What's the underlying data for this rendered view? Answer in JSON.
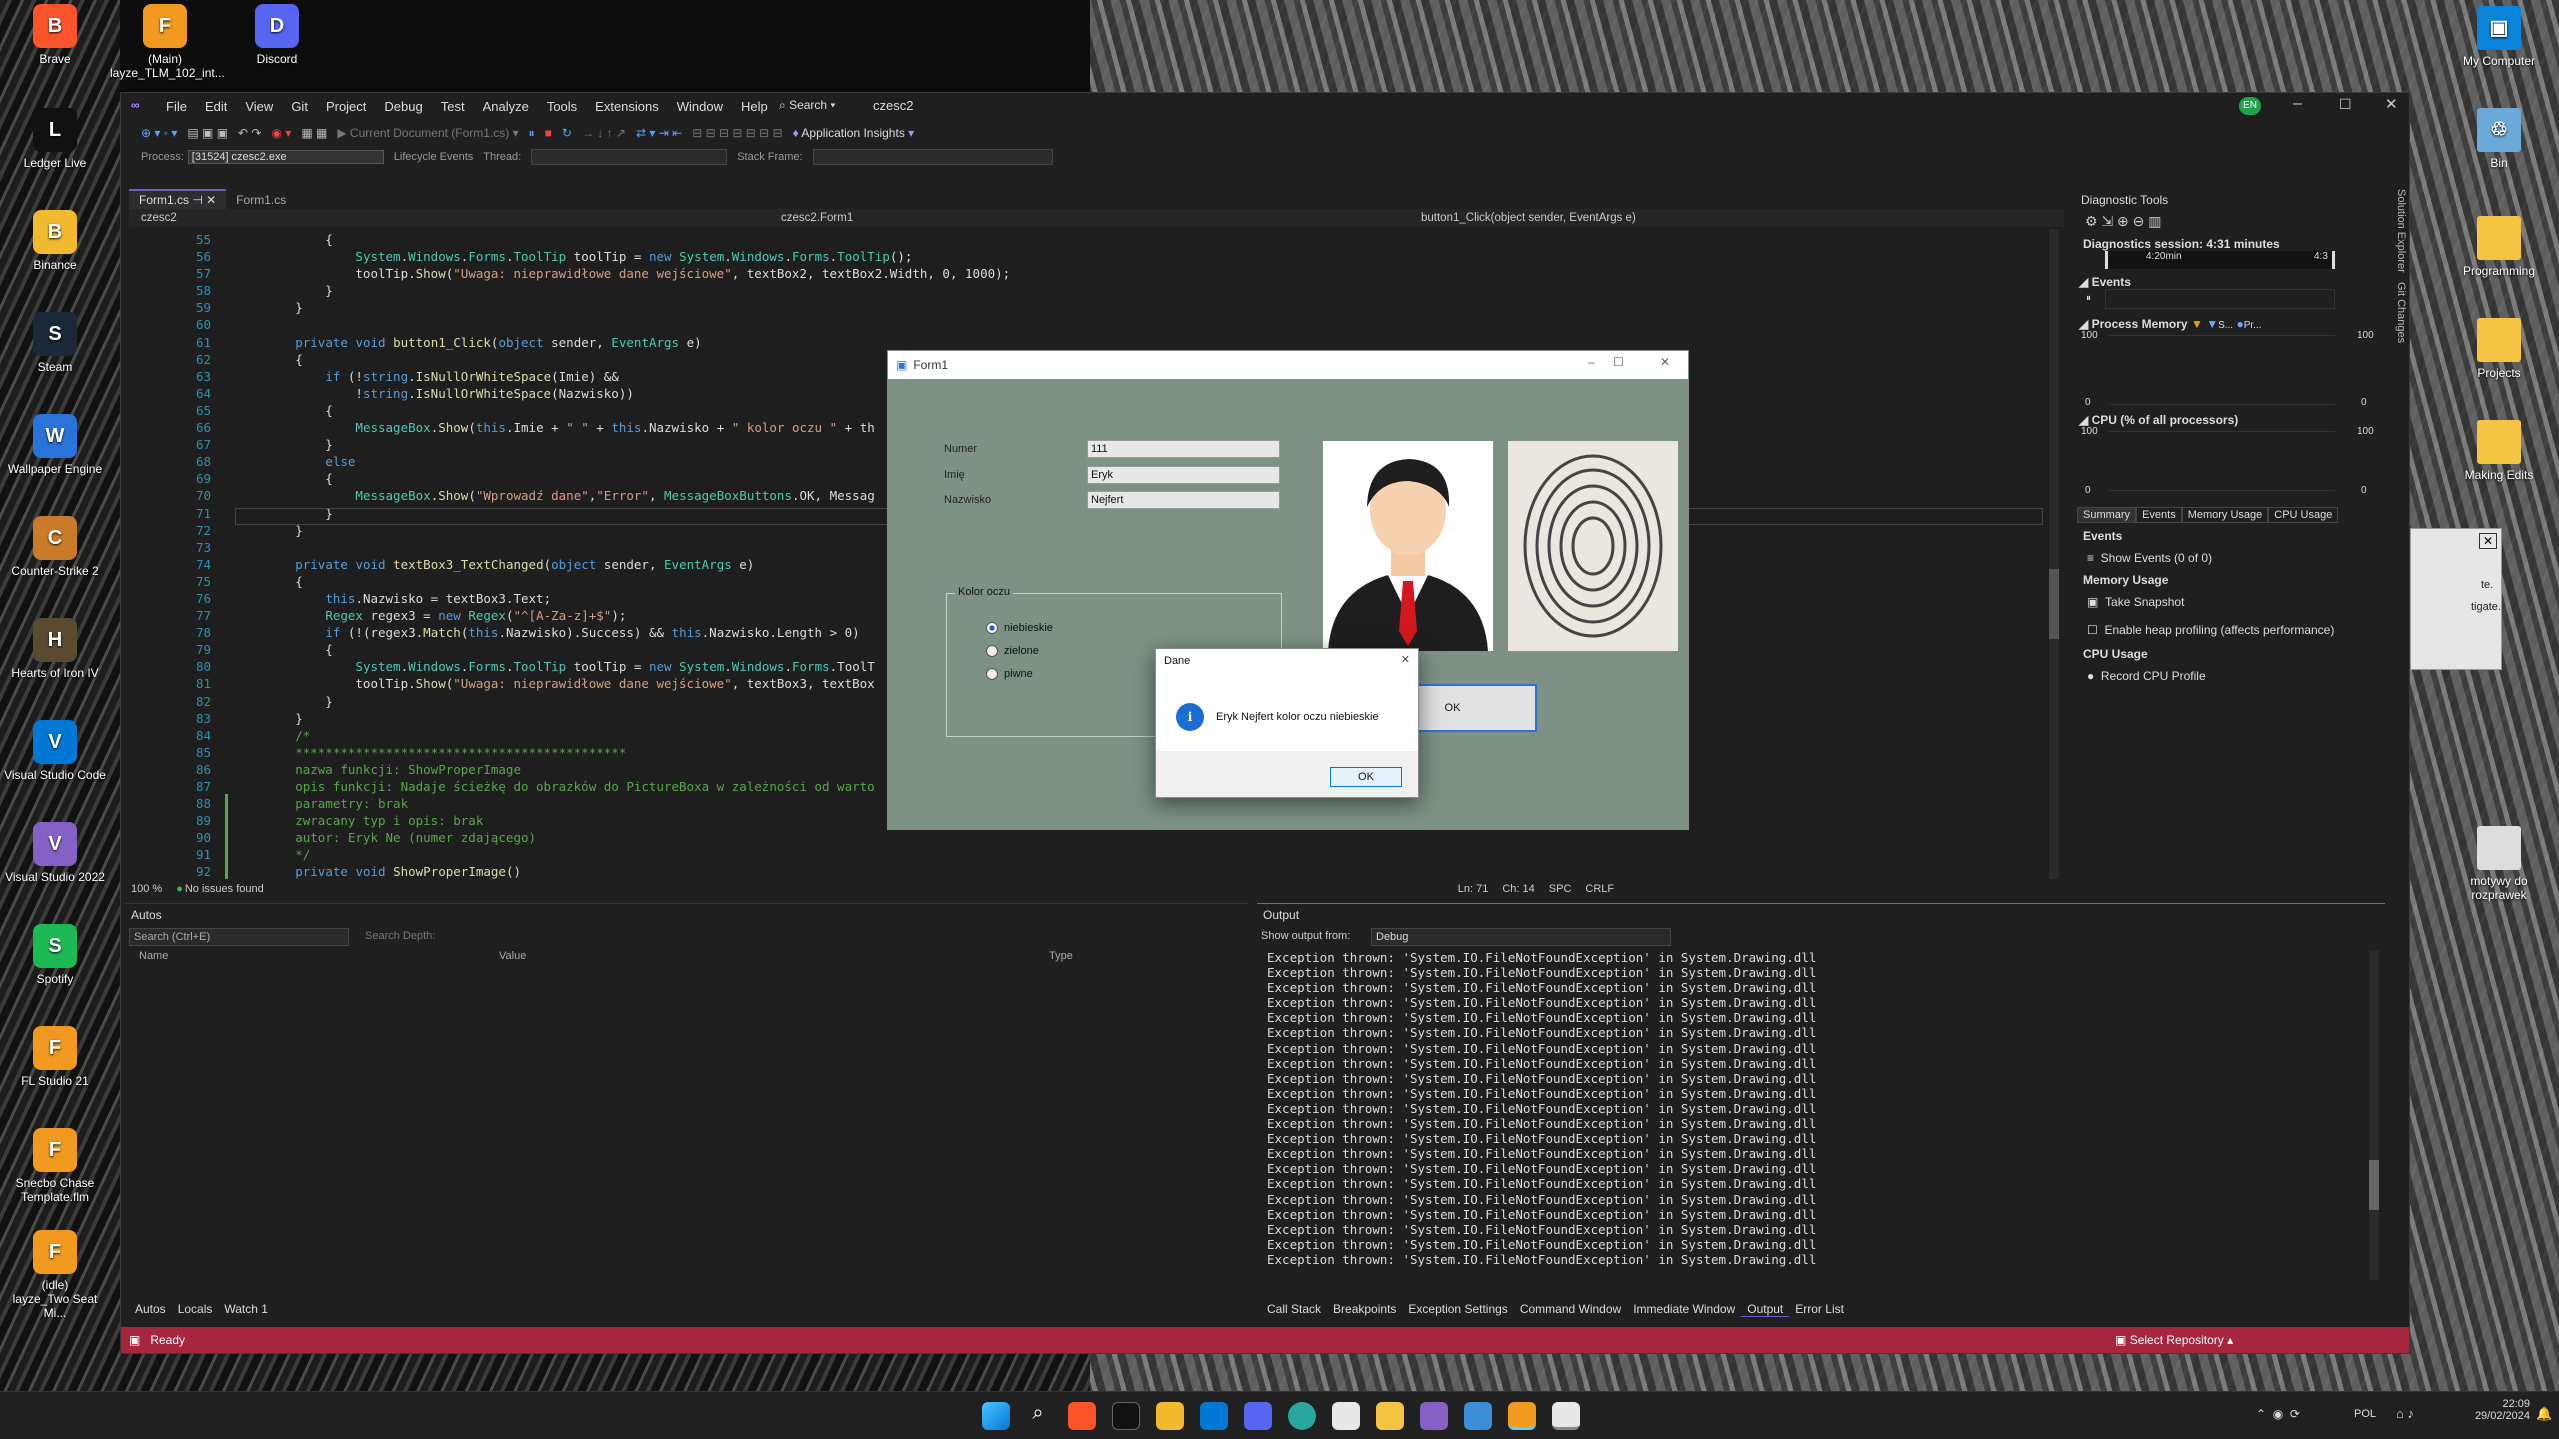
{
  "desktop_left": [
    {
      "label": "Brave",
      "color": "#fb542b",
      "glyph": "B"
    },
    {
      "label": "(Main)\nlayze_TLM_102_int...",
      "color": "#f29a1f",
      "glyph": "F"
    },
    {
      "label": "Discord",
      "color": "#5865f2",
      "glyph": "D"
    },
    {
      "label": "Ledger Live",
      "color": "#111",
      "glyph": "L"
    },
    {
      "label": "Binance",
      "color": "#f3ba2f",
      "glyph": "B"
    },
    {
      "label": "Steam",
      "color": "#1b2838",
      "glyph": "S"
    },
    {
      "label": "Wallpaper Engine",
      "color": "#2a73d9",
      "glyph": "W"
    },
    {
      "label": "Counter-Strike 2",
      "color": "#c97b2a",
      "glyph": "C"
    },
    {
      "label": "Hearts of Iron IV",
      "color": "#5a4a32",
      "glyph": "H"
    },
    {
      "label": "Visual Studio Code",
      "color": "#0078d4",
      "glyph": "V"
    },
    {
      "label": "Visual Studio 2022",
      "color": "#8661c5",
      "glyph": "V"
    },
    {
      "label": "Spotify",
      "color": "#1db954",
      "glyph": "S"
    },
    {
      "label": "FL Studio 21",
      "color": "#f29a1f",
      "glyph": "F"
    },
    {
      "label": "Snecbo Chase Template.flm",
      "color": "#f29a1f",
      "glyph": "F"
    },
    {
      "label": "(idle)\nlayze_Two Seat Mi...",
      "color": "#f29a1f",
      "glyph": "F"
    }
  ],
  "desktop_right": [
    {
      "label": "My Computer",
      "color": "#0a84d8",
      "glyph": "▣"
    },
    {
      "label": "Bin",
      "color": "#6aa9d8",
      "glyph": "♲"
    },
    {
      "label": "Programming",
      "color": "#f4c542",
      "glyph": ""
    },
    {
      "label": "Projects",
      "color": "#f4c542",
      "glyph": ""
    },
    {
      "label": "Making Edits",
      "color": "#f4c542",
      "glyph": ""
    },
    {
      "label": "motywy do rozprawek",
      "color": "#ddd",
      "glyph": ""
    }
  ],
  "vs": {
    "menu": [
      "File",
      "Edit",
      "View",
      "Git",
      "Project",
      "Debug",
      "Test",
      "Analyze",
      "Tools",
      "Extensions",
      "Window",
      "Help"
    ],
    "search": "Search",
    "solution": "czesc2",
    "lang_badge": "EN",
    "toolbar_current_doc": "Current Document (Form1.cs)",
    "app_insights": "Application Insights",
    "process_label": "Process:",
    "process_value": "[31524] czesc2.exe",
    "lifecycle": "Lifecycle Events",
    "thread": "Thread:",
    "stack_frame": "Stack Frame:",
    "tabs": [
      "Form1.cs",
      "Form1.cs"
    ],
    "nav": [
      "czesc2",
      "czesc2.Form1",
      "button1_Click(object sender, EventArgs e)"
    ],
    "zoom": "100 %",
    "issues": "No issues found",
    "pos": [
      "Ln: 71",
      "Ch: 14",
      "SPC",
      "CRLF"
    ],
    "status": "Ready",
    "select_repo": "Select Repository"
  },
  "code_lines": [
    {
      "n": "55",
      "t": "            {"
    },
    {
      "n": "56",
      "t": "                System.Windows.Forms.ToolTip toolTip = new System.Windows.Forms.ToolTip();"
    },
    {
      "n": "57",
      "t": "                toolTip.Show(\"Uwaga: nieprawidłowe dane wejściowe\", textBox2, textBox2.Width, 0, 1000);"
    },
    {
      "n": "58",
      "t": "            }"
    },
    {
      "n": "59",
      "t": "        }"
    },
    {
      "n": "60",
      "t": ""
    },
    {
      "n": "61",
      "t": "        private void button1_Click(object sender, EventArgs e)"
    },
    {
      "n": "62",
      "t": "        {"
    },
    {
      "n": "63",
      "t": "            if (!string.IsNullOrWhiteSpace(Imie) &&"
    },
    {
      "n": "64",
      "t": "                !string.IsNullOrWhiteSpace(Nazwisko))"
    },
    {
      "n": "65",
      "t": "            {"
    },
    {
      "n": "66",
      "t": "                MessageBox.Show(this.Imie + \" \" + this.Nazwisko + \" kolor oczu \" + th"
    },
    {
      "n": "67",
      "t": "            }"
    },
    {
      "n": "68",
      "t": "            else"
    },
    {
      "n": "69",
      "t": "            {"
    },
    {
      "n": "70",
      "t": "                MessageBox.Show(\"Wprowadź dane\",\"Error\", MessageBoxButtons.OK, Messag"
    },
    {
      "n": "71",
      "t": "            }"
    },
    {
      "n": "72",
      "t": "        }"
    },
    {
      "n": "73",
      "t": ""
    },
    {
      "n": "74",
      "t": "        private void textBox3_TextChanged(object sender, EventArgs e)"
    },
    {
      "n": "75",
      "t": "        {"
    },
    {
      "n": "76",
      "t": "            this.Nazwisko = textBox3.Text;"
    },
    {
      "n": "77",
      "t": "            Regex regex3 = new Regex(\"^[A-Za-z]+$\");"
    },
    {
      "n": "78",
      "t": "            if (!(regex3.Match(this.Nazwisko).Success) && this.Nazwisko.Length > 0)"
    },
    {
      "n": "79",
      "t": "            {"
    },
    {
      "n": "80",
      "t": "                System.Windows.Forms.ToolTip toolTip = new System.Windows.Forms.ToolT"
    },
    {
      "n": "81",
      "t": "                toolTip.Show(\"Uwaga: nieprawidłowe dane wejściowe\", textBox3, textBox"
    },
    {
      "n": "82",
      "t": "            }"
    },
    {
      "n": "83",
      "t": "        }"
    },
    {
      "n": "84",
      "t": "        /*"
    },
    {
      "n": "85",
      "t": "        ********************************************"
    },
    {
      "n": "86",
      "t": "        nazwa funkcji: ShowProperImage"
    },
    {
      "n": "87",
      "t": "        opis funkcji: Nadaje ścieżkę do obrazków do PictureBoxa w zależności od warto"
    },
    {
      "n": "88",
      "t": "        parametry: brak"
    },
    {
      "n": "89",
      "t": "        zwracany typ i opis: brak"
    },
    {
      "n": "90",
      "t": "        autor: Eryk Ne (numer zdającego)"
    },
    {
      "n": "91",
      "t": "        */"
    },
    {
      "n": "92",
      "t": "        private void ShowProperImage()"
    }
  ],
  "autos": {
    "title": "Autos",
    "search": "Search (Ctrl+E)",
    "depth": "Search Depth:",
    "cols": [
      "Name",
      "Value",
      "Type"
    ],
    "tabs": [
      "Autos",
      "Locals",
      "Watch 1"
    ]
  },
  "output": {
    "title": "Output",
    "show_from": "Show output from:",
    "source": "Debug",
    "line": "Exception thrown: 'System.IO.FileNotFoundException' in System.Drawing.dll",
    "count": 21,
    "tabs": [
      "Call Stack",
      "Breakpoints",
      "Exception Settings",
      "Command Window",
      "Immediate Window",
      "Output",
      "Error List"
    ]
  },
  "diag": {
    "title": "Diagnostic Tools",
    "session": "Diagnostics session: 4:31 minutes",
    "t1": "4:20min",
    "t2": "4:3",
    "events": "Events",
    "mem": "Process Memory",
    "mem_legend": [
      "S...",
      "Pr..."
    ],
    "cpu": "CPU (% of all processors)",
    "axis_top": "100",
    "axis_bot": "0",
    "tabs": [
      "Summary",
      "Events",
      "Memory Usage",
      "CPU Usage"
    ],
    "sec_events": "Events",
    "show_events": "Show Events (0 of 0)",
    "sec_mem": "Memory Usage",
    "snapshot": "Take Snapshot",
    "heap": "Enable heap profiling (affects performance)",
    "sec_cpu": "CPU Usage",
    "record": "Record CPU Profile",
    "side": [
      "Solution Explorer",
      "Git Changes"
    ]
  },
  "form1": {
    "title": "Form1",
    "labels": [
      "Numer",
      "Imię",
      "Nazwisko"
    ],
    "values": [
      "111",
      "Eryk",
      "Nejfert"
    ],
    "group": "Kolor oczu",
    "radios": [
      "niebieskie",
      "zielone",
      "piwne"
    ],
    "ok": "OK"
  },
  "dialog": {
    "title": "Dane",
    "message": "Eryk Nejfert kolor oczu niebieskie",
    "ok": "OK"
  },
  "bg_window": {
    "line1": "te.",
    "line2": "tigate."
  },
  "taskbar": {
    "lang": "POL",
    "time": "22:09",
    "date": "29/02/2024"
  }
}
